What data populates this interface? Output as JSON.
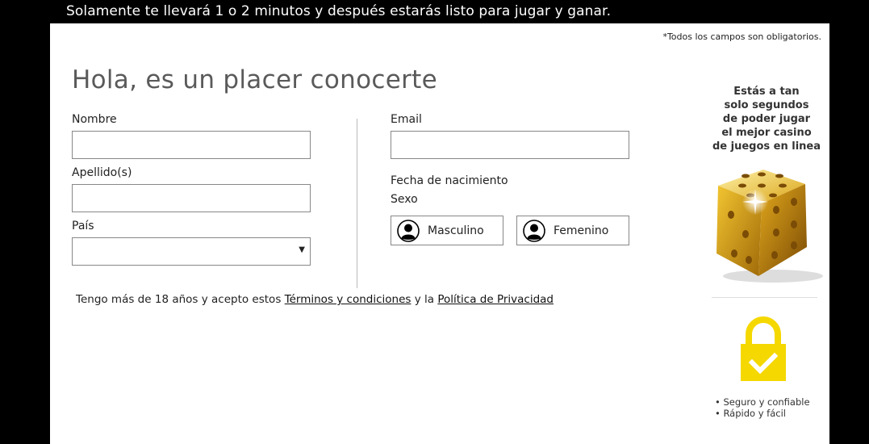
{
  "banner": "Solamente te llevará 1 o 2 minutos y después estarás listo para jugar y ganar.",
  "required_note": "*Todos los campos son obligatorios.",
  "title": "Hola, es un placer conocerte",
  "form": {
    "nombre_label": "Nombre",
    "nombre_value": "",
    "apellidos_label": "Apellido(s)",
    "apellidos_value": "",
    "pais_label": "País",
    "pais_value": "",
    "email_label": "Email",
    "email_value": "",
    "birth_label": "Fecha de nacimiento",
    "sexo_label": "Sexo",
    "male_label": "Masculino",
    "female_label": "Femenino"
  },
  "terms": {
    "prefix": "Tengo más de 18 años y acepto estos ",
    "terms_link": "Términos y condiciones",
    "middle": " y la ",
    "privacy_link": "Política de Privacidad"
  },
  "side": {
    "lines": [
      "Estás a tan",
      "solo segundos",
      "de poder jugar",
      "el mejor casino",
      "de juegos en linea"
    ],
    "bullets": [
      "• Seguro y confiable",
      "• Rápido y fácil"
    ],
    "dice_icon": "gold-dice-icon",
    "lock_icon": "padlock-check-icon",
    "accent_color": "#f5d800"
  }
}
